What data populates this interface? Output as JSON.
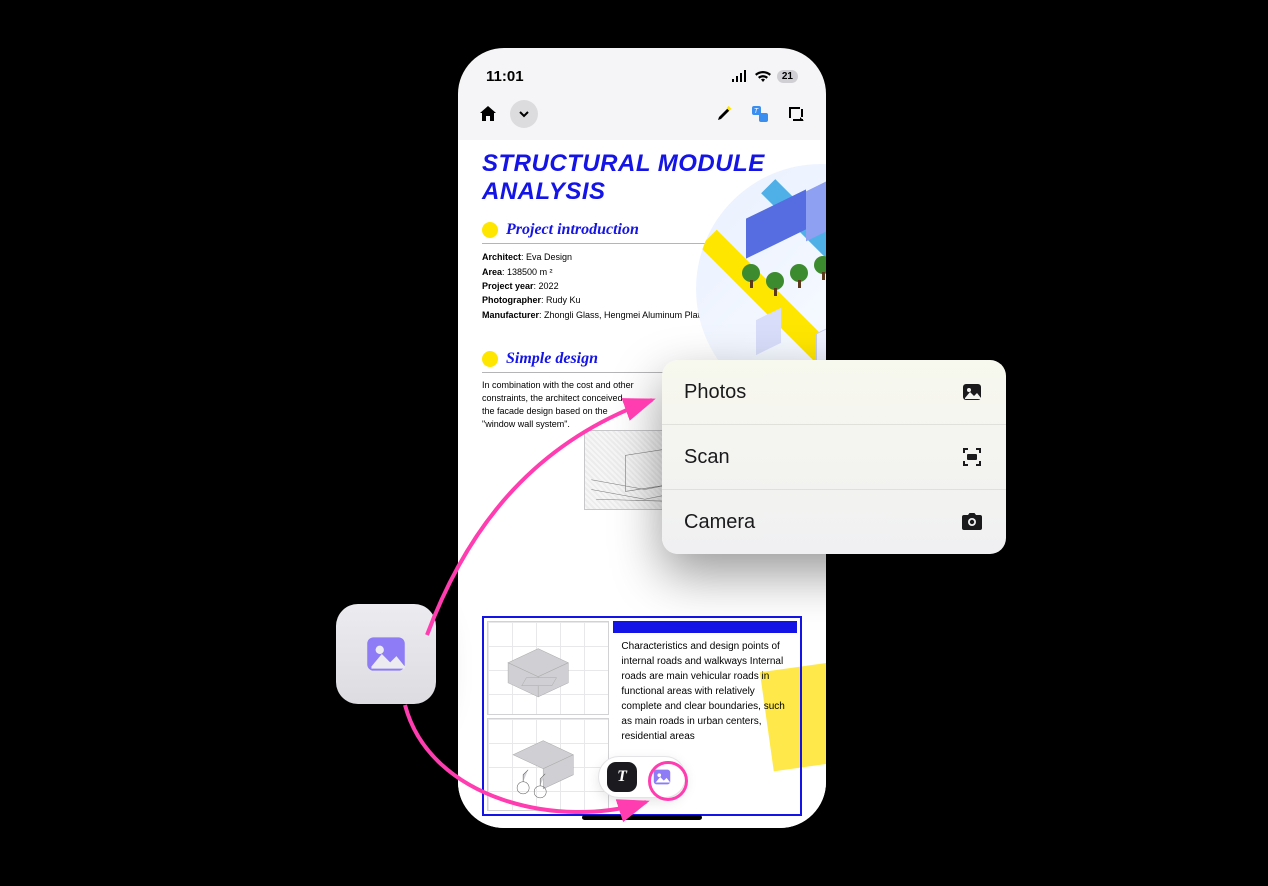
{
  "status": {
    "time": "11:01",
    "battery": "21"
  },
  "doc": {
    "title": "STRUCTURAL MODULE ANALYSIS",
    "sections": {
      "intro": {
        "title": "Project introduction",
        "meta": [
          {
            "k": "Architect",
            "v": "Eva Design"
          },
          {
            "k": "Area",
            "v": "138500 m ²"
          },
          {
            "k": "Project year",
            "v": "2022"
          },
          {
            "k": "Photographer",
            "v": "Rudy Ku"
          },
          {
            "k": "Manufacturer",
            "v": "Zhongli Glass, Hengmei Aluminum Plate, Xiao Elevator"
          }
        ]
      },
      "simple": {
        "title": "Simple design",
        "body": "In combination with the cost and other constraints, the architect conceived the facade design based on the \"window wall system\"."
      },
      "lower_text": "Characteristics and design points of internal roads and walkways Internal roads are main vehicular roads in functional areas with relatively complete and clear boundaries, such as main roads in urban centers, residential areas"
    }
  },
  "menu": {
    "items": [
      {
        "label": "Photos",
        "icon": "photo-icon"
      },
      {
        "label": "Scan",
        "icon": "scan-icon"
      },
      {
        "label": "Camera",
        "icon": "camera-icon"
      }
    ]
  },
  "colors": {
    "accent_blue": "#1414e6",
    "highlight_yellow": "#ffe600",
    "annotation_pink": "#ff3db0",
    "callout_purple": "#8d7cf6"
  }
}
